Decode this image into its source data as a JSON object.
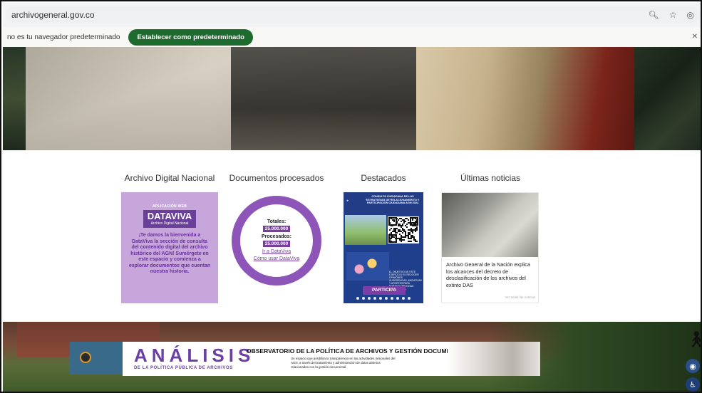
{
  "browser": {
    "url": "archivogeneral.gov.co",
    "icons": [
      "zoom-icon",
      "star-icon",
      "profile-icon"
    ]
  },
  "default_bar": {
    "message": "no es tu navegador predeterminado",
    "button": "Establecer como predeterminado"
  },
  "sections": {
    "archivo": "Archivo Digital Nacional",
    "documentos": "Documentos procesados",
    "destacados": "Destacados",
    "noticias": "Últimas noticias"
  },
  "dataviva": {
    "app_label": "APLICACIÓN WEB",
    "title": "DATAVIVA",
    "subtitle": "Archivo Digital Nacional",
    "text": "¡Te damos la bienvenida a DataViva la sección de consulta del contenido digital del archivo histórico del AGN! Sumérgete en este espacio y comienza a explorar documentos que cuentan nuestra historia."
  },
  "documentos": {
    "totales_label": "Totales:",
    "totales_value": "25.000.000",
    "procesados_label": "Procesados:",
    "procesados_value": "25.000.000",
    "link_ir": "Ir a DataViva",
    "link_como": "Cómo usar DataViva",
    "processed_fraction": 1.0,
    "color": "#8e55b8"
  },
  "destacados": {
    "poster_title": "CONSULTA CIUDADANA DE LAS ESTRATEGIAS DE RELACIONAMIENTO Y PARTICIPACIÓN CIUDADANA AGN 2024",
    "poster_side": "EL OBJETIVO DE ESTE EJERCICIO ES RECOGER OPINIONES, SUGERENCIAS, INICIATIVAS Y APORTES PARA FORTALECER ESTAS ESTRATEGIAS",
    "button": "PARTICIPA",
    "slide_count": 10
  },
  "noticias": {
    "headline": "Archivo General de la Nación explica los alcances del decreto de desclasificación de los archivos del extinto DAS",
    "more": "Ver todas las noticias"
  },
  "banner": {
    "title": "ANÁLISIS",
    "subtitle": "DE LA POLÍTICA PÚBLICA DE ARCHIVOS",
    "observatorio": "OBSERVATORIO DE LA POLÍTICA DE ARCHIVOS Y GESTIÓN DOCUMENTAL",
    "description": "Un espacio que posibilita la transparencia en las actividades misionales del AGN, a través del tratamiento y administración de datos abiertos relacionados con la gestión documental."
  }
}
